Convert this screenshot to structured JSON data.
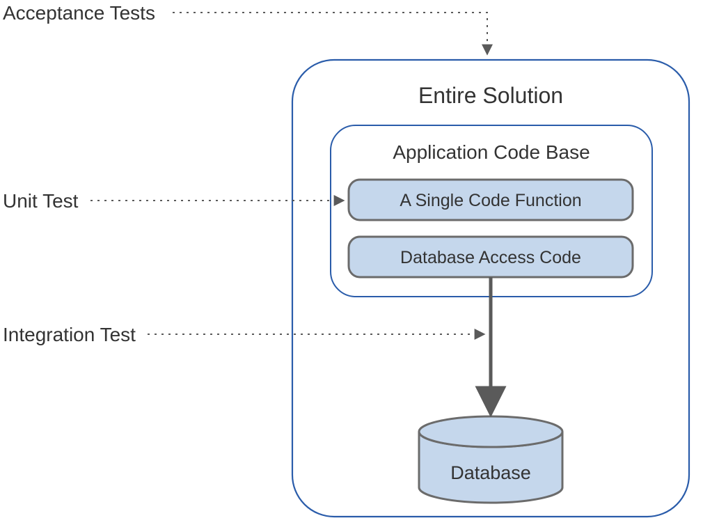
{
  "labels": {
    "acceptance": "Acceptance Tests",
    "unit": "Unit Test",
    "integration": "Integration Test",
    "solution": "Entire Solution",
    "appcode": "Application Code Base",
    "single_fn": "A Single Code Function",
    "db_access": "Database Access Code",
    "database": "Database"
  },
  "colors": {
    "outline_blue": "#2a5caa",
    "box_fill": "#c5d7ec",
    "box_stroke": "#6b6b6b",
    "dotted": "#5a5a5a",
    "solid_arrow": "#5a5a5a"
  }
}
